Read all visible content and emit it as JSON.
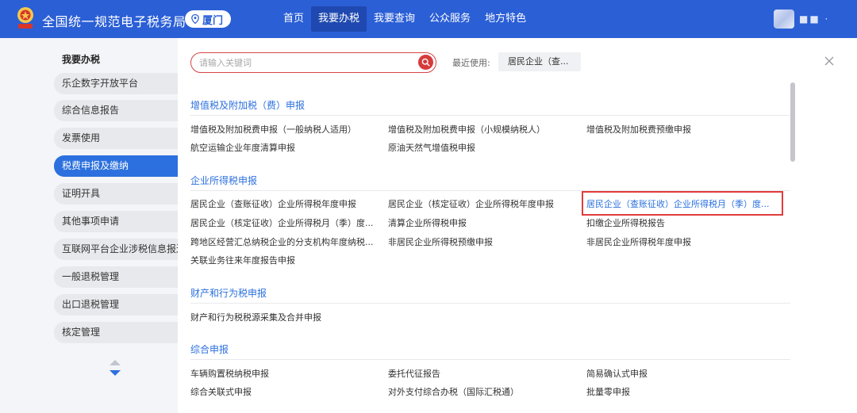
{
  "header": {
    "title": "全国统一规范电子税务局",
    "city": "厦门",
    "nav": [
      "首页",
      "我要办税",
      "我要查询",
      "公众服务",
      "地方特色"
    ],
    "nav_active_index": 1,
    "user_name": "■■ ·",
    "colors": {
      "brand": "#2b5fd6",
      "nav_active": "#1f49b0",
      "accent": "#2b70de",
      "highlight_border": "#e23b3b"
    }
  },
  "sidebar": {
    "title": "我要办税",
    "items": [
      {
        "label": "乐企数字开放平台",
        "active": false
      },
      {
        "label": "综合信息报告",
        "active": false
      },
      {
        "label": "发票使用",
        "active": false
      },
      {
        "label": "税费申报及缴纳",
        "active": true
      },
      {
        "label": "证明开具",
        "active": false
      },
      {
        "label": "其他事项申请",
        "active": false
      },
      {
        "label": "互联网平台企业涉税信息报送",
        "active": false
      },
      {
        "label": "一般退税管理",
        "active": false
      },
      {
        "label": "出口退税管理",
        "active": false
      },
      {
        "label": "核定管理",
        "active": false
      }
    ]
  },
  "panel": {
    "search": {
      "placeholder": "请输入关键词",
      "value": ""
    },
    "recent_label": "最近使用:",
    "recent_item": "居民企业（查...",
    "categories": [
      {
        "title": "增值税及附加税（费）申报",
        "items": [
          "增值税及附加税费申报（一般纳税人适用）",
          "增值税及附加税费申报（小规模纳税人）",
          "增值税及附加税费预缴申报",
          "航空运输企业年度清算申报",
          "原油天然气增值税申报"
        ]
      },
      {
        "title": "企业所得税申报",
        "items": [
          "居民企业（查账征收）企业所得税年度申报",
          "居民企业（核定征收）企业所得税年度申报",
          "居民企业（查账征收）企业所得税月（季）度...",
          "居民企业（核定征收）企业所得税月（季）度...",
          "清算企业所得税申报",
          "扣缴企业所得税报告",
          "跨地区经营汇总纳税企业的分支机构年度纳税...",
          "非居民企业所得税预缴申报",
          "非居民企业所得税年度申报",
          "关联业务往来年度报告申报"
        ]
      },
      {
        "title": "财产和行为税申报",
        "items": [
          "财产和行为税税源采集及合并申报"
        ]
      },
      {
        "title": "综合申报",
        "items": [
          "车辆购置税纳税申报",
          "委托代征报告",
          "简易确认式申报",
          "综合关联式申报",
          "对外支付综合办税（国际汇税通）",
          "批量零申报"
        ]
      }
    ],
    "highlighted_item": "居民企业（查账征收）企业所得税月（季）度..."
  }
}
